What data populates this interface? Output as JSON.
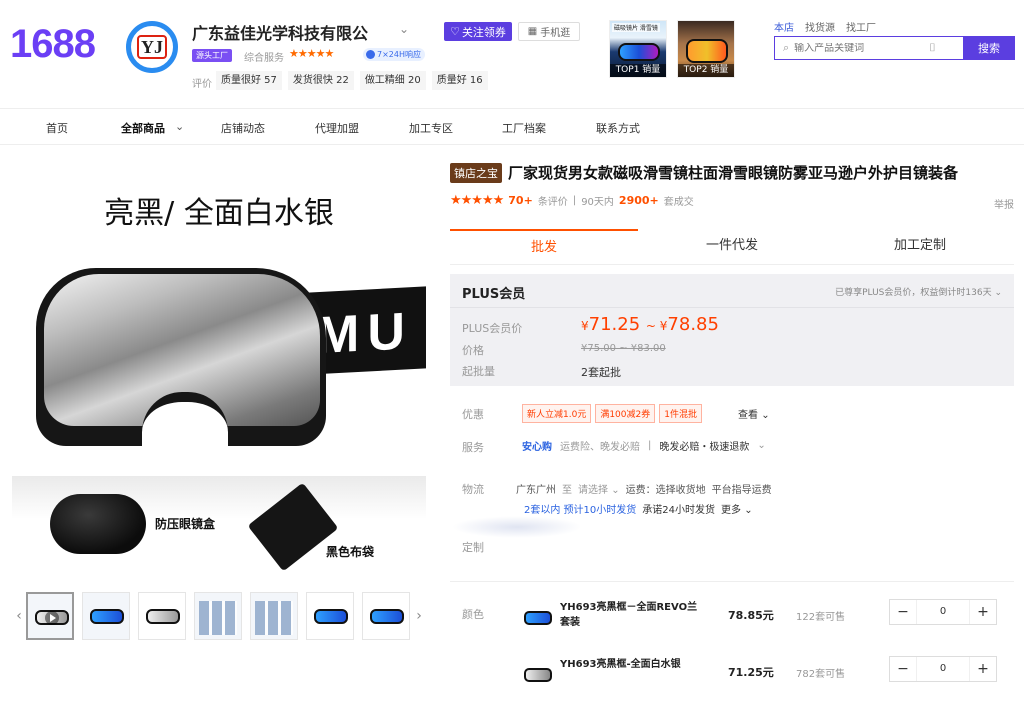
{
  "header": {
    "logo": "1688",
    "avatar_text": "YJ",
    "shop_name": "广东益佳光学科技有限公",
    "follow_label": "关注领券",
    "mobile_label": "手机逛",
    "factory_badge": "源头工厂",
    "service_label": "综合服务",
    "service_stars": "★★★★★",
    "response_badge": "7×24H响应",
    "review_label": "评价",
    "review_tags": [
      {
        "text": "质量很好 57"
      },
      {
        "text": "发货很快 22"
      },
      {
        "text": "做工精细 20"
      },
      {
        "text": "质量好 16"
      }
    ],
    "top_products": [
      {
        "caption": "磁吸镜片 滑雪镜",
        "rank": "TOP1 销量"
      },
      {
        "caption": "",
        "rank": "TOP2 销量"
      }
    ],
    "search_tabs": [
      "本店",
      "找货源",
      "找工厂"
    ],
    "search_placeholder": "输入产品关键词",
    "search_button": "搜索"
  },
  "nav": {
    "items": [
      {
        "label": "首页"
      },
      {
        "label": "全部商品"
      },
      {
        "label": "店铺动态"
      },
      {
        "label": "代理加盟"
      },
      {
        "label": "加工专区"
      },
      {
        "label": "工厂档案"
      },
      {
        "label": "联系方式"
      }
    ]
  },
  "gallery": {
    "main_caption": "亮黑/ 全面白水银",
    "strap_text": "MU",
    "promo_case_label": "防压眼镜盒",
    "promo_pouch_label": "黑色布袋",
    "thumb_count": 7
  },
  "product": {
    "tag": "镇店之宝",
    "title": "厂家现货男女款磁吸滑雪镜柱面滑雪眼镜防雾亚马逊户外护目镜装备",
    "stars": "★★★★★",
    "review_count": "70+",
    "review_suffix": "条评价",
    "days_label": "90天内",
    "sold_count": "2900+",
    "sold_suffix": "套成交",
    "report": "举报",
    "tabs": [
      "批发",
      "一件代发",
      "加工定制"
    ],
    "plus": {
      "title": "PLUS会员",
      "note": "已尊享PLUS会员价，权益倒计时136天",
      "price_label": "PLUS会员价",
      "price_low": "71.25",
      "price_high": "78.85",
      "currency": "¥",
      "orig_label": "价格",
      "orig_price": "¥75.00 ~ ¥83.00",
      "moq_label": "起批量",
      "moq": "2套起批"
    },
    "coupon_label": "优惠",
    "coupons": [
      "新人立减1.0元",
      "满100减2券",
      "1件混批"
    ],
    "coupon_more": "查看",
    "service_label": "服务",
    "service_main": "安心购",
    "service_sub": "运费险、晚发必赔",
    "service_extra": "晚发必赔・极速退款",
    "ship_label": "物流",
    "ship_from": "广东广州",
    "ship_to_prefix": "至",
    "ship_to": "请选择",
    "freight": "运费：选择收货地",
    "freight_note": "平台指导运费",
    "delivery": "2套以内 预计10小时发货",
    "promise": "承诺24小时发货",
    "more": "更多",
    "custom_label": "定制",
    "color_label": "颜色",
    "skus": [
      {
        "name": "YH693亮黑框－全面REVO兰套装",
        "price": "78.85元",
        "stock": "122套可售",
        "qty": "0",
        "lens": "blue"
      },
      {
        "name": "YH693亮黑框-全面白水银",
        "price": "71.25元",
        "stock": "782套可售",
        "qty": "0",
        "lens": "silver"
      }
    ]
  },
  "colors": {
    "brand": "#5b3ee0",
    "accent": "#ff5000",
    "link": "#2a62e0"
  }
}
